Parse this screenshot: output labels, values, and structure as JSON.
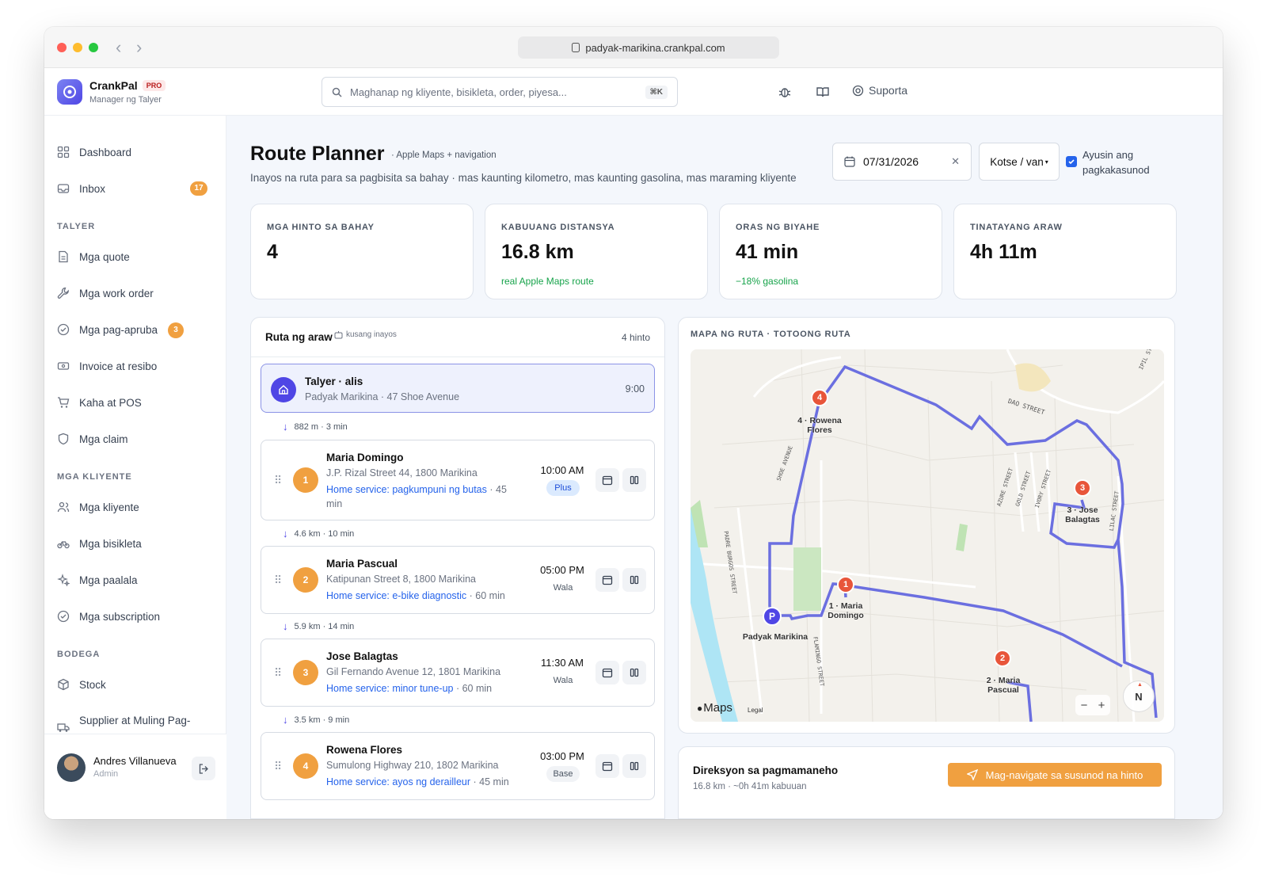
{
  "browser": {
    "url": "padyak-marikina.crankpal.com"
  },
  "app": {
    "name": "CrankPal",
    "plan_badge": "PRO",
    "role": "Manager ng Talyer"
  },
  "search": {
    "placeholder": "Maghanap ng kliyente, bisikleta, order, piyesa...",
    "shortcut": "⌘K"
  },
  "topbar": {
    "support_label": "Suporta"
  },
  "sidebar": {
    "top_items": [
      {
        "label": "Dashboard",
        "icon": "grid-icon"
      },
      {
        "label": "Inbox",
        "icon": "inbox-icon",
        "badge": "17"
      }
    ],
    "sections": [
      {
        "title": "TALYER",
        "items": [
          {
            "label": "Mga quote",
            "icon": "document-icon"
          },
          {
            "label": "Mga work order",
            "icon": "wrench-icon"
          },
          {
            "label": "Mga pag-apruba",
            "icon": "check-circle-icon",
            "badge": "3"
          },
          {
            "label": "Invoice at resibo",
            "icon": "receipt-icon"
          },
          {
            "label": "Kaha at POS",
            "icon": "cart-icon"
          },
          {
            "label": "Mga claim",
            "icon": "shield-icon"
          }
        ]
      },
      {
        "title": "MGA KLIYENTE",
        "items": [
          {
            "label": "Mga kliyente",
            "icon": "users-icon"
          },
          {
            "label": "Mga bisikleta",
            "icon": "bicycle-icon"
          },
          {
            "label": "Mga paalala",
            "icon": "sparkle-icon"
          },
          {
            "label": "Mga subscription",
            "icon": "check-circle-icon"
          }
        ]
      },
      {
        "title": "BODEGA",
        "items": [
          {
            "label": "Stock",
            "icon": "box-icon"
          },
          {
            "label": "Supplier at Muling Pag-",
            "icon": "truck-icon"
          }
        ]
      }
    ],
    "user": {
      "name": "Andres Villanueva",
      "role": "Admin"
    }
  },
  "page": {
    "title": "Route Planner",
    "title_note": "· Apple Maps + navigation",
    "description": "Inayos na ruta para sa pagbisita sa bahay · mas kaunting kilometro, mas kaunting gasolina, mas maraming kliyente",
    "date": "07/31/2026",
    "vehicle": "Kotse / van",
    "optimize_label_1": "Ayusin ang",
    "optimize_label_2": "pagkakasunod",
    "optimize_checked": true
  },
  "kpis": [
    {
      "label": "MGA HINTO SA BAHAY",
      "value": "4",
      "note": ""
    },
    {
      "label": "KABUUANG DISTANSYA",
      "value": "16.8 km",
      "note": "real Apple Maps route"
    },
    {
      "label": "ORAS NG BIYAHE",
      "value": "41 min",
      "note": "−18% gasolina"
    },
    {
      "label": "TINATAYANG ARAW",
      "value": "4h 11m",
      "note": ""
    }
  ],
  "route": {
    "title": "Ruta ng araw",
    "auto_label": "kusang inayos",
    "count": "4 hinto",
    "depot": {
      "name": "Talyer · alis",
      "address": "Padyak Marikina · 47 Shoe Avenue",
      "time": "9:00"
    },
    "legs": [
      "882 m · 3 min",
      "4.6 km · 10 min",
      "5.9 km · 14 min",
      "3.5 km · 9 min"
    ],
    "stops": [
      {
        "num": "1",
        "name": "Maria Domingo",
        "address": "J.P. Rizal Street 44, 1800 Marikina",
        "service": "Home service: pagkumpuni ng butas",
        "duration": "· 45 min",
        "time": "10:00 AM",
        "tag": "Plus"
      },
      {
        "num": "2",
        "name": "Maria Pascual",
        "address": "Katipunan Street 8, 1800 Marikina",
        "service": "Home service: e-bike diagnostic",
        "duration": "· 60 min",
        "time": "05:00 PM",
        "tag": "Wala"
      },
      {
        "num": "3",
        "name": "Jose Balagtas",
        "address": "Gil Fernando Avenue 12, 1801 Marikina",
        "service": "Home service: minor tune-up",
        "duration": "· 60 min",
        "time": "11:30 AM",
        "tag": "Wala"
      },
      {
        "num": "4",
        "name": "Rowena Flores",
        "address": "Sumulong Highway 210, 1802 Marikina",
        "service": "Home service: ayos ng derailleur",
        "duration": "· 45 min",
        "time": "03:00 PM",
        "tag": "Base"
      }
    ]
  },
  "map": {
    "title": "MAPA NG RUTA · TOTOONG RUTA",
    "brand": "Maps",
    "legal": "Legal",
    "compass": "N",
    "depot_pin": "P",
    "depot_label": "Padyak Marikina",
    "pins": [
      {
        "num": "1",
        "label_1": "1 · Maria",
        "label_2": "Domingo"
      },
      {
        "num": "2",
        "label_1": "2 · Maria",
        "label_2": "Pascual"
      },
      {
        "num": "3",
        "label_1": "3 · Jose",
        "label_2": "Balagtas"
      },
      {
        "num": "4",
        "label_1": "4 · Rowena",
        "label_2": "Flores"
      }
    ],
    "streets": [
      "DAO STREET",
      "SHOE AVENUE",
      "PADRE BURGOS STREET",
      "FLAMINGO STREET",
      "LILAC STREET",
      "AZURE STREET",
      "GOLD STREET",
      "IVORY STREET",
      "IPIL ST"
    ],
    "route_color": "#6b6fe0",
    "pin_color": "#e8553a"
  },
  "directions": {
    "title": "Direksyon sa pagmamaneho",
    "summary": "16.8 km · ~0h 41m kabuuan",
    "button": "Mag-navigate sa susunod na hinto"
  }
}
